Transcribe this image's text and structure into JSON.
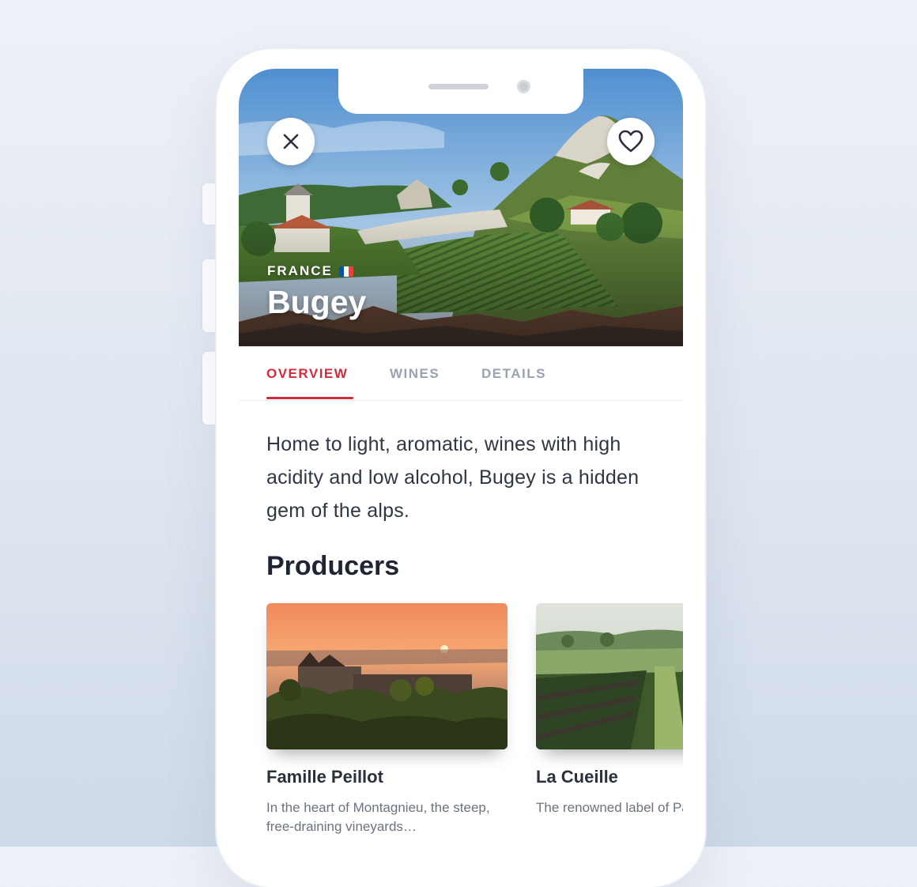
{
  "region": {
    "country": "FRANCE",
    "flag_colors": [
      "#0055a4",
      "#ffffff",
      "#ef4135"
    ],
    "name": "Bugey"
  },
  "actions": {
    "close_icon": "close-icon",
    "favorite_icon": "heart-icon"
  },
  "tabs": [
    {
      "label": "OVERVIEW",
      "active": true
    },
    {
      "label": "WINES",
      "active": false
    },
    {
      "label": "DETAILS",
      "active": false
    }
  ],
  "description": "Home to light, aromatic, wines with high acidity and low alcohol, Bugey is a hidden gem of the alps.",
  "producers": {
    "title": "Producers",
    "items": [
      {
        "name": "Famille Peillot",
        "description": "In the heart of Montagnieu, the steep, free-draining vineyards…"
      },
      {
        "name": "La Cueille",
        "description": "The renowned label of Patrick Bottex."
      }
    ]
  },
  "colors": {
    "accent": "#d42b3a",
    "tab_inactive": "#9aa2b1",
    "text": "#2f3644"
  }
}
